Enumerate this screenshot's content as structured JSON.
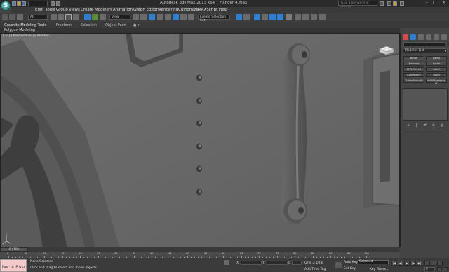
{
  "titlebar": {
    "app_title": "Autodesk 3ds Max 2013 x64",
    "document": "Hanger 4.max",
    "workspace": "",
    "search_placeholder": "Type a keyword or phrase",
    "logo_letter": "S"
  },
  "menu": [
    "Edit",
    "Tools",
    "Group",
    "Views",
    "Create",
    "Modifiers",
    "Animation",
    "Graph Editors",
    "Rendering",
    "Customize",
    "MAXScript",
    "Help"
  ],
  "toolbar": {
    "filter": "All",
    "ref_coord": "View",
    "selection_set": "Create Selection Set"
  },
  "ribbon": {
    "tabs": [
      "Graphite Modeling Tools",
      "Freeform",
      "Selection",
      "Object Paint"
    ],
    "subpanel": "Polygon Modeling"
  },
  "viewport": {
    "label": "[ + ] [ Perspective ] [ Shaded ]"
  },
  "command_panel": {
    "modifier_list": "Modifier List",
    "buttons": [
      "Bevel",
      "Bend",
      "Extrude",
      "Lathe",
      "FFD 3x3x3",
      "Shell",
      "Symmetry",
      "Taper",
      "TurboSmooth",
      "UVW Mapping XF"
    ],
    "stack_icons": [
      "pin-icon",
      "show-end-result-icon",
      "make-unique-icon",
      "remove-modifier-icon",
      "configure-icon"
    ]
  },
  "timeline": {
    "thumb": "0 / 100",
    "ticks": [
      "0",
      "5",
      "10",
      "15",
      "20",
      "25",
      "30",
      "35",
      "40",
      "45",
      "50",
      "55",
      "60",
      "65",
      "70",
      "75",
      "80",
      "85",
      "90",
      "95",
      "100"
    ]
  },
  "status": {
    "maxscript": "Max to Physc",
    "selection_info": "None Selected",
    "prompt": "Click and drag to select and move objects",
    "x_label": "X:",
    "y_label": "Y:",
    "z_label": "Z:",
    "grid": "Grid = 10,0",
    "add_time_tag": "Add Time Tag",
    "auto_key": "Auto Key",
    "set_key": "Set Key",
    "selected_dropdown": "Selected",
    "key_filters": "Key Filters...",
    "frame": "0"
  },
  "colors": {
    "accent": "#2e7fd0",
    "viewport_bg": "#6d6d6d",
    "maxscript_bg": "#f4c9c9"
  }
}
